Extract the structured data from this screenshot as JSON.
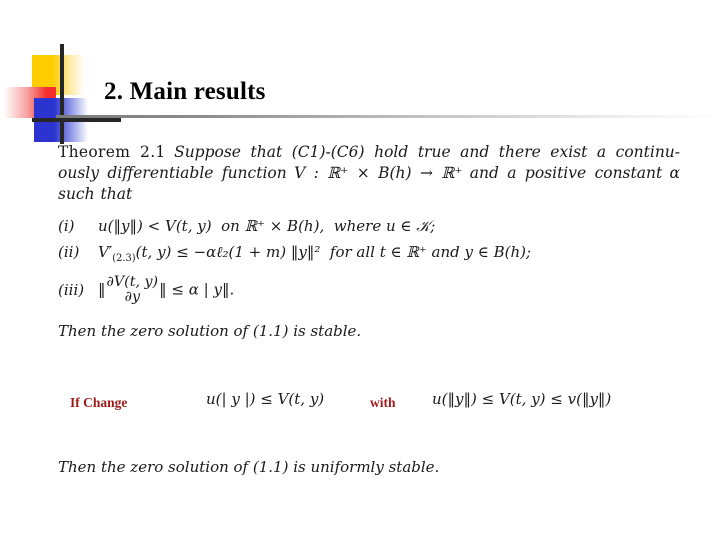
{
  "slide": {
    "title": "2. Main results",
    "background_color": "#ffffff",
    "ornament": {
      "yellow_color": "#ffcc00",
      "red_color": "#f52d2d",
      "blue_color": "#2b34cf",
      "crosshair_color": "#262626"
    },
    "rule_color": "#7a7a7a"
  },
  "theorem": {
    "label": "Theorem 2.1",
    "statement": "Suppose that (C1)-(C6) hold true and there exist a continuously differentiable function V : ℝ⁺ × B(h) → ℝ⁺ and a positive constant α such that",
    "statement_parts": {
      "lead": "Suppose that (C1)-(C6) hold true and there exist a continu-",
      "mid_a": "ously differentiable function",
      "func": "V : ℝ⁺ × B(h) → ℝ⁺",
      "mid_b": "and a positive constant",
      "alpha": "α",
      "tail": "such that"
    },
    "items": [
      {
        "tag": "(i)",
        "text": "u(‖y‖) < V(t, y) on ℝ⁺ × B(h), where u ∈ 𝒦;",
        "lhs": "u(‖y‖)",
        "relation": "<",
        "rhs": "V(t, y)",
        "domain": "on ℝ⁺ × B(h),",
        "qualifier": "where u ∈ 𝒦;"
      },
      {
        "tag": "(ii)",
        "text": "V′(2.3)(t, y) ≤ −αℓ₂(1 + m)‖y‖² for all t ∈ ℝ⁺ and y ∈ B(h);",
        "lhs_base": "V",
        "lhs_prime": "′",
        "lhs_sub": "(2.3)",
        "lhs_args": "(t, y)",
        "relation": "≤",
        "rhs": "−αℓ₂(1 + m) ‖y‖²",
        "qualifier": "for all t ∈ ℝ⁺ and y ∈ B(h);"
      },
      {
        "tag": "(iii)",
        "text": "‖ ∂V(t, y) / ∂y ‖ ≤ α | y‖.",
        "frac_numerator": "∂V(t, y)",
        "frac_denominator": "∂y",
        "relation": "≤",
        "rhs": "α | y‖."
      }
    ],
    "conclusion": "Then the zero solution of (1.1) is stable."
  },
  "annotation": {
    "if_label": "If Change",
    "if_formula": "u(| y |) ≤ V(t, y)",
    "with_label": "with",
    "with_formula": "u(‖y‖) ≤ V(t, y) ≤ v(‖y‖)",
    "label_color": "#9e1b1b"
  },
  "final": {
    "text": "Then the zero solution of (1.1) is uniformly stable."
  }
}
